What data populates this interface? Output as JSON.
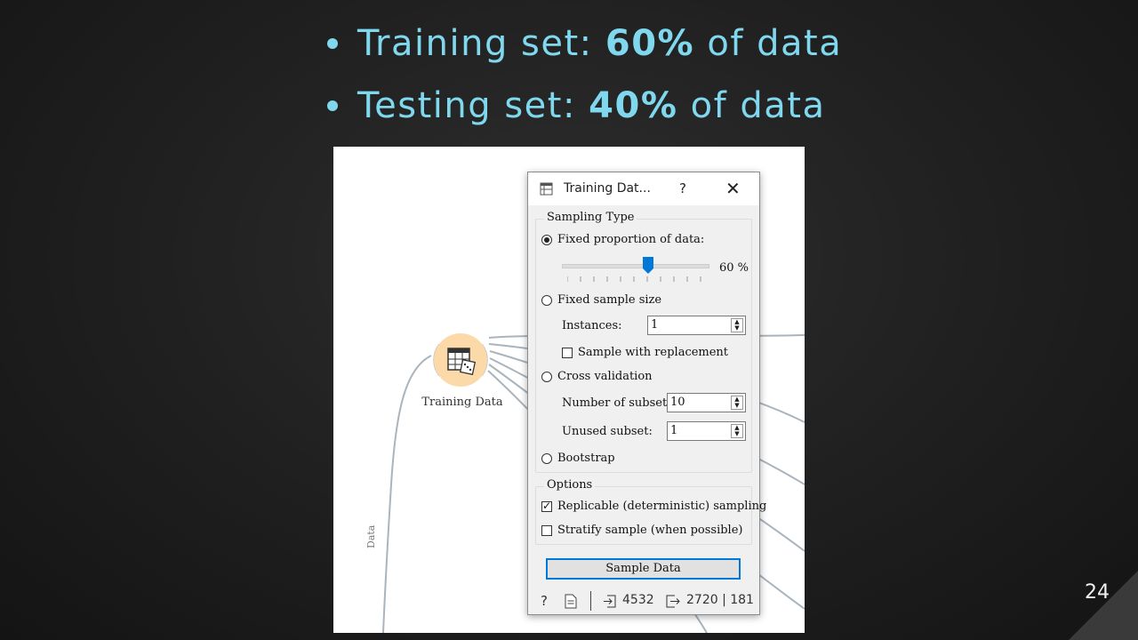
{
  "slide": {
    "bullets": [
      {
        "prefix": "Training set: ",
        "bold": "60%",
        "suffix": " of data"
      },
      {
        "prefix": "Testing set: ",
        "bold": "40%",
        "suffix": " of data"
      }
    ],
    "page_number": "24"
  },
  "canvas": {
    "widget_label": "Training Data",
    "link_label": "Data"
  },
  "dialog": {
    "title": "Training Dat...",
    "help": "?",
    "close": "✕",
    "sampling_type": {
      "title": "Sampling Type",
      "fixed_proportion_label": "Fixed proportion of data:",
      "proportion_value": "60 %",
      "proportion_percent": 60,
      "fixed_sample_label": "Fixed sample size",
      "instances_label": "Instances:",
      "instances_value": "1",
      "replacement_label": "Sample with replacement",
      "cross_validation_label": "Cross validation",
      "subsets_label": "Number of subsets:",
      "subsets_value": "10",
      "unused_label": "Unused subset:",
      "unused_value": "1",
      "bootstrap_label": "Bootstrap"
    },
    "options": {
      "title": "Options",
      "replicable_label": "Replicable (deterministic) sampling",
      "replicable_checked": true,
      "stratify_label": "Stratify sample (when possible)",
      "stratify_checked": false
    },
    "sample_button": "Sample Data",
    "status": {
      "input_count": "4532",
      "output_counts": "2720 | 181"
    }
  }
}
